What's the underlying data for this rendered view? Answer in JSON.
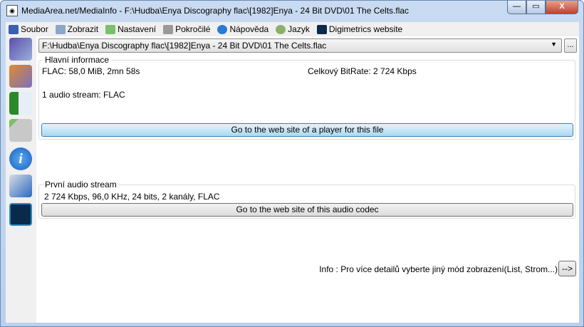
{
  "window": {
    "title": "MediaArea.net/MediaInfo - F:\\Hudba\\Enya Discography flac\\[1982]Enya - 24 Bit DVD\\01 The Celts.flac",
    "minimize": "—",
    "maximize": "▭",
    "close": "X"
  },
  "menu": [
    {
      "label": "Soubor",
      "icon": "file-icon",
      "color": "#3a5fb0"
    },
    {
      "label": "Zobrazit",
      "icon": "view-icon",
      "color": "#8aa6c8"
    },
    {
      "label": "Nastavení",
      "icon": "settings-icon",
      "color": "#7bbf6a"
    },
    {
      "label": "Pokročilé",
      "icon": "advanced-icon",
      "color": "#999999"
    },
    {
      "label": "Nápověda",
      "icon": "help-icon",
      "color": "#2a7ad8"
    },
    {
      "label": "Jazyk",
      "icon": "globe-icon",
      "color": "#8bb06a"
    },
    {
      "label": "Digimetrics website",
      "icon": "digimetrics-icon",
      "color": "#0a2a4a"
    }
  ],
  "sidebar": [
    {
      "icon": "open-file-icon",
      "color": "#5a4fb0"
    },
    {
      "icon": "open-folder-icon",
      "color": "#e08a30"
    },
    {
      "icon": "export-icon",
      "color": "#2a8a2a"
    },
    {
      "icon": "preferences-icon",
      "color": "#a0a0a0"
    },
    {
      "icon": "about-icon",
      "color": "#2a7ad8"
    },
    {
      "icon": "reports-icon",
      "color": "#b0b8c8"
    },
    {
      "icon": "digimetrics-icon",
      "color": "#0a2a4a"
    }
  ],
  "file_select": {
    "value": "F:\\Hudba\\Enya Discography flac\\[1982]Enya - 24 Bit DVD\\01 The Celts.flac",
    "browse": "..."
  },
  "general": {
    "label": "Hlavní informace",
    "format": "FLAC: 58,0 MiB, 2mn 58s",
    "bitrate": "Celkový BitRate: 2 724 Kbps",
    "streams": "1 audio stream: FLAC",
    "player_button": "Go to the web site of a player for this file"
  },
  "audio": {
    "label": "První audio stream",
    "details": "2 724 Kbps, 96,0 KHz, 24 bits, 2 kanály, FLAC",
    "codec_button": "Go to the web site of this audio codec"
  },
  "footer": {
    "info": "Info : Pro více detailů vyberte jiný mód zobrazení(List, Strom...)",
    "next": "-->"
  }
}
